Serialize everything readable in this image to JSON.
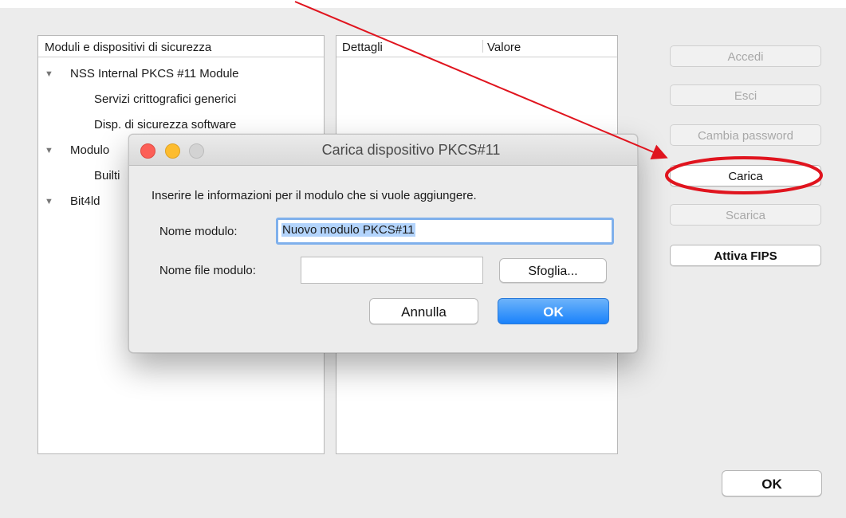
{
  "tree_panel": {
    "header": "Moduli e dispositivi di sicurezza",
    "rows": [
      {
        "label": "NSS Internal PKCS #11 Module",
        "expanded": true,
        "level": 0
      },
      {
        "label": "Servizi crittografici generici",
        "level": 1
      },
      {
        "label": "Disp. di sicurezza software",
        "level": 1
      },
      {
        "label": "Modulo",
        "expanded": true,
        "level": 0
      },
      {
        "label": "Builti",
        "level": 1
      },
      {
        "label": "Bit4ld",
        "expanded": true,
        "level": 0
      }
    ]
  },
  "details_panel": {
    "col_details": "Dettagli",
    "col_value": "Valore"
  },
  "side_buttons": {
    "accedi": {
      "label": "Accedi",
      "enabled": false
    },
    "esci": {
      "label": "Esci",
      "enabled": false
    },
    "cambia_password": {
      "label": "Cambia password",
      "enabled": false
    },
    "carica": {
      "label": "Carica",
      "enabled": true
    },
    "scarica": {
      "label": "Scarica",
      "enabled": false
    },
    "attiva_fips": {
      "label": "Attiva FIPS",
      "enabled": true
    }
  },
  "ok_button": {
    "label": "OK"
  },
  "dialog": {
    "title": "Carica dispositivo PKCS#11",
    "instructions": "Inserire le informazioni per il modulo che si vuole aggiungere.",
    "module_name_label": "Nome modulo:",
    "module_name_value": "Nuovo modulo PKCS#11",
    "module_file_label": "Nome file modulo:",
    "module_file_value": "",
    "browse_label": "Sfoglia...",
    "cancel_label": "Annulla",
    "ok_label": "OK"
  },
  "colors": {
    "annotation_red": "#e0141e",
    "primary_blue": "#1a82fb",
    "focus_ring": "#7fb0ec"
  }
}
